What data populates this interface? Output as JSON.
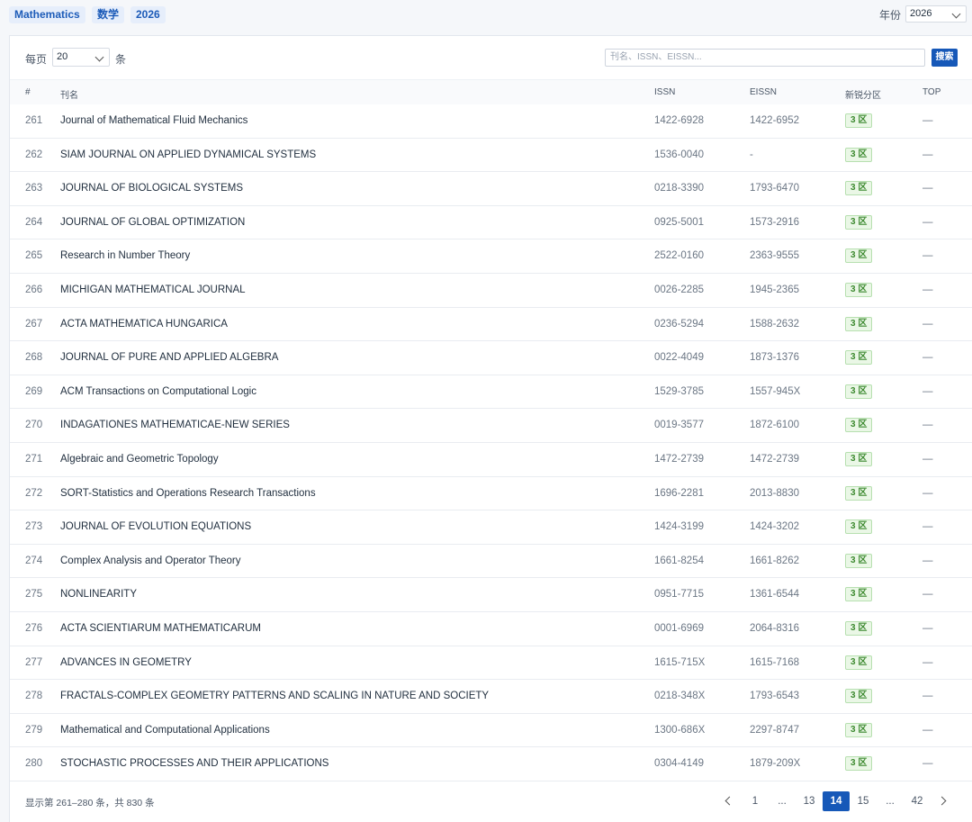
{
  "header": {
    "tags": [
      "Mathematics",
      "数学",
      "2026"
    ],
    "year_label": "年份",
    "year_value": "2026"
  },
  "toolbar": {
    "per_page_prefix": "每页",
    "per_page_value": "20",
    "per_page_suffix": "条",
    "search_placeholder": "刊名、ISSN、EISSN...",
    "search_button": "搜索"
  },
  "table": {
    "columns": [
      "#",
      "刊名",
      "ISSN",
      "EISSN",
      "新锐分区",
      "TOP"
    ],
    "rows": [
      {
        "num": "261",
        "title": "Journal of Mathematical Fluid Mechanics",
        "issn": "1422-6928",
        "eissn": "1422-6952",
        "zone": "3 区",
        "top": "—"
      },
      {
        "num": "262",
        "title": "SIAM JOURNAL ON APPLIED DYNAMICAL SYSTEMS",
        "issn": "1536-0040",
        "eissn": "-",
        "zone": "3 区",
        "top": "—"
      },
      {
        "num": "263",
        "title": "JOURNAL OF BIOLOGICAL SYSTEMS",
        "issn": "0218-3390",
        "eissn": "1793-6470",
        "zone": "3 区",
        "top": "—"
      },
      {
        "num": "264",
        "title": "JOURNAL OF GLOBAL OPTIMIZATION",
        "issn": "0925-5001",
        "eissn": "1573-2916",
        "zone": "3 区",
        "top": "—"
      },
      {
        "num": "265",
        "title": "Research in Number Theory",
        "issn": "2522-0160",
        "eissn": "2363-9555",
        "zone": "3 区",
        "top": "—"
      },
      {
        "num": "266",
        "title": "MICHIGAN MATHEMATICAL JOURNAL",
        "issn": "0026-2285",
        "eissn": "1945-2365",
        "zone": "3 区",
        "top": "—"
      },
      {
        "num": "267",
        "title": "ACTA MATHEMATICA HUNGARICA",
        "issn": "0236-5294",
        "eissn": "1588-2632",
        "zone": "3 区",
        "top": "—"
      },
      {
        "num": "268",
        "title": "JOURNAL OF PURE AND APPLIED ALGEBRA",
        "issn": "0022-4049",
        "eissn": "1873-1376",
        "zone": "3 区",
        "top": "—"
      },
      {
        "num": "269",
        "title": "ACM Transactions on Computational Logic",
        "issn": "1529-3785",
        "eissn": "1557-945X",
        "zone": "3 区",
        "top": "—"
      },
      {
        "num": "270",
        "title": "INDAGATIONES MATHEMATICAE-NEW SERIES",
        "issn": "0019-3577",
        "eissn": "1872-6100",
        "zone": "3 区",
        "top": "—"
      },
      {
        "num": "271",
        "title": "Algebraic and Geometric Topology",
        "issn": "1472-2739",
        "eissn": "1472-2739",
        "zone": "3 区",
        "top": "—"
      },
      {
        "num": "272",
        "title": "SORT-Statistics and Operations Research Transactions",
        "issn": "1696-2281",
        "eissn": "2013-8830",
        "zone": "3 区",
        "top": "—"
      },
      {
        "num": "273",
        "title": "JOURNAL OF EVOLUTION EQUATIONS",
        "issn": "1424-3199",
        "eissn": "1424-3202",
        "zone": "3 区",
        "top": "—"
      },
      {
        "num": "274",
        "title": "Complex Analysis and Operator Theory",
        "issn": "1661-8254",
        "eissn": "1661-8262",
        "zone": "3 区",
        "top": "—"
      },
      {
        "num": "275",
        "title": "NONLINEARITY",
        "issn": "0951-7715",
        "eissn": "1361-6544",
        "zone": "3 区",
        "top": "—"
      },
      {
        "num": "276",
        "title": "ACTA SCIENTIARUM MATHEMATICARUM",
        "issn": "0001-6969",
        "eissn": "2064-8316",
        "zone": "3 区",
        "top": "—"
      },
      {
        "num": "277",
        "title": "ADVANCES IN GEOMETRY",
        "issn": "1615-715X",
        "eissn": "1615-7168",
        "zone": "3 区",
        "top": "—"
      },
      {
        "num": "278",
        "title": "FRACTALS-COMPLEX GEOMETRY PATTERNS AND SCALING IN NATURE AND SOCIETY",
        "issn": "0218-348X",
        "eissn": "1793-6543",
        "zone": "3 区",
        "top": "—"
      },
      {
        "num": "279",
        "title": "Mathematical and Computational Applications",
        "issn": "1300-686X",
        "eissn": "2297-8747",
        "zone": "3 区",
        "top": "—"
      },
      {
        "num": "280",
        "title": "STOCHASTIC PROCESSES AND THEIR APPLICATIONS",
        "issn": "0304-4149",
        "eissn": "1879-209X",
        "zone": "3 区",
        "top": "—"
      }
    ]
  },
  "footer": {
    "summary": "显示第 261–280 条，共 830 条",
    "pages": [
      "1",
      "...",
      "13",
      "14",
      "15",
      "...",
      "42"
    ],
    "current_page": "14"
  }
}
